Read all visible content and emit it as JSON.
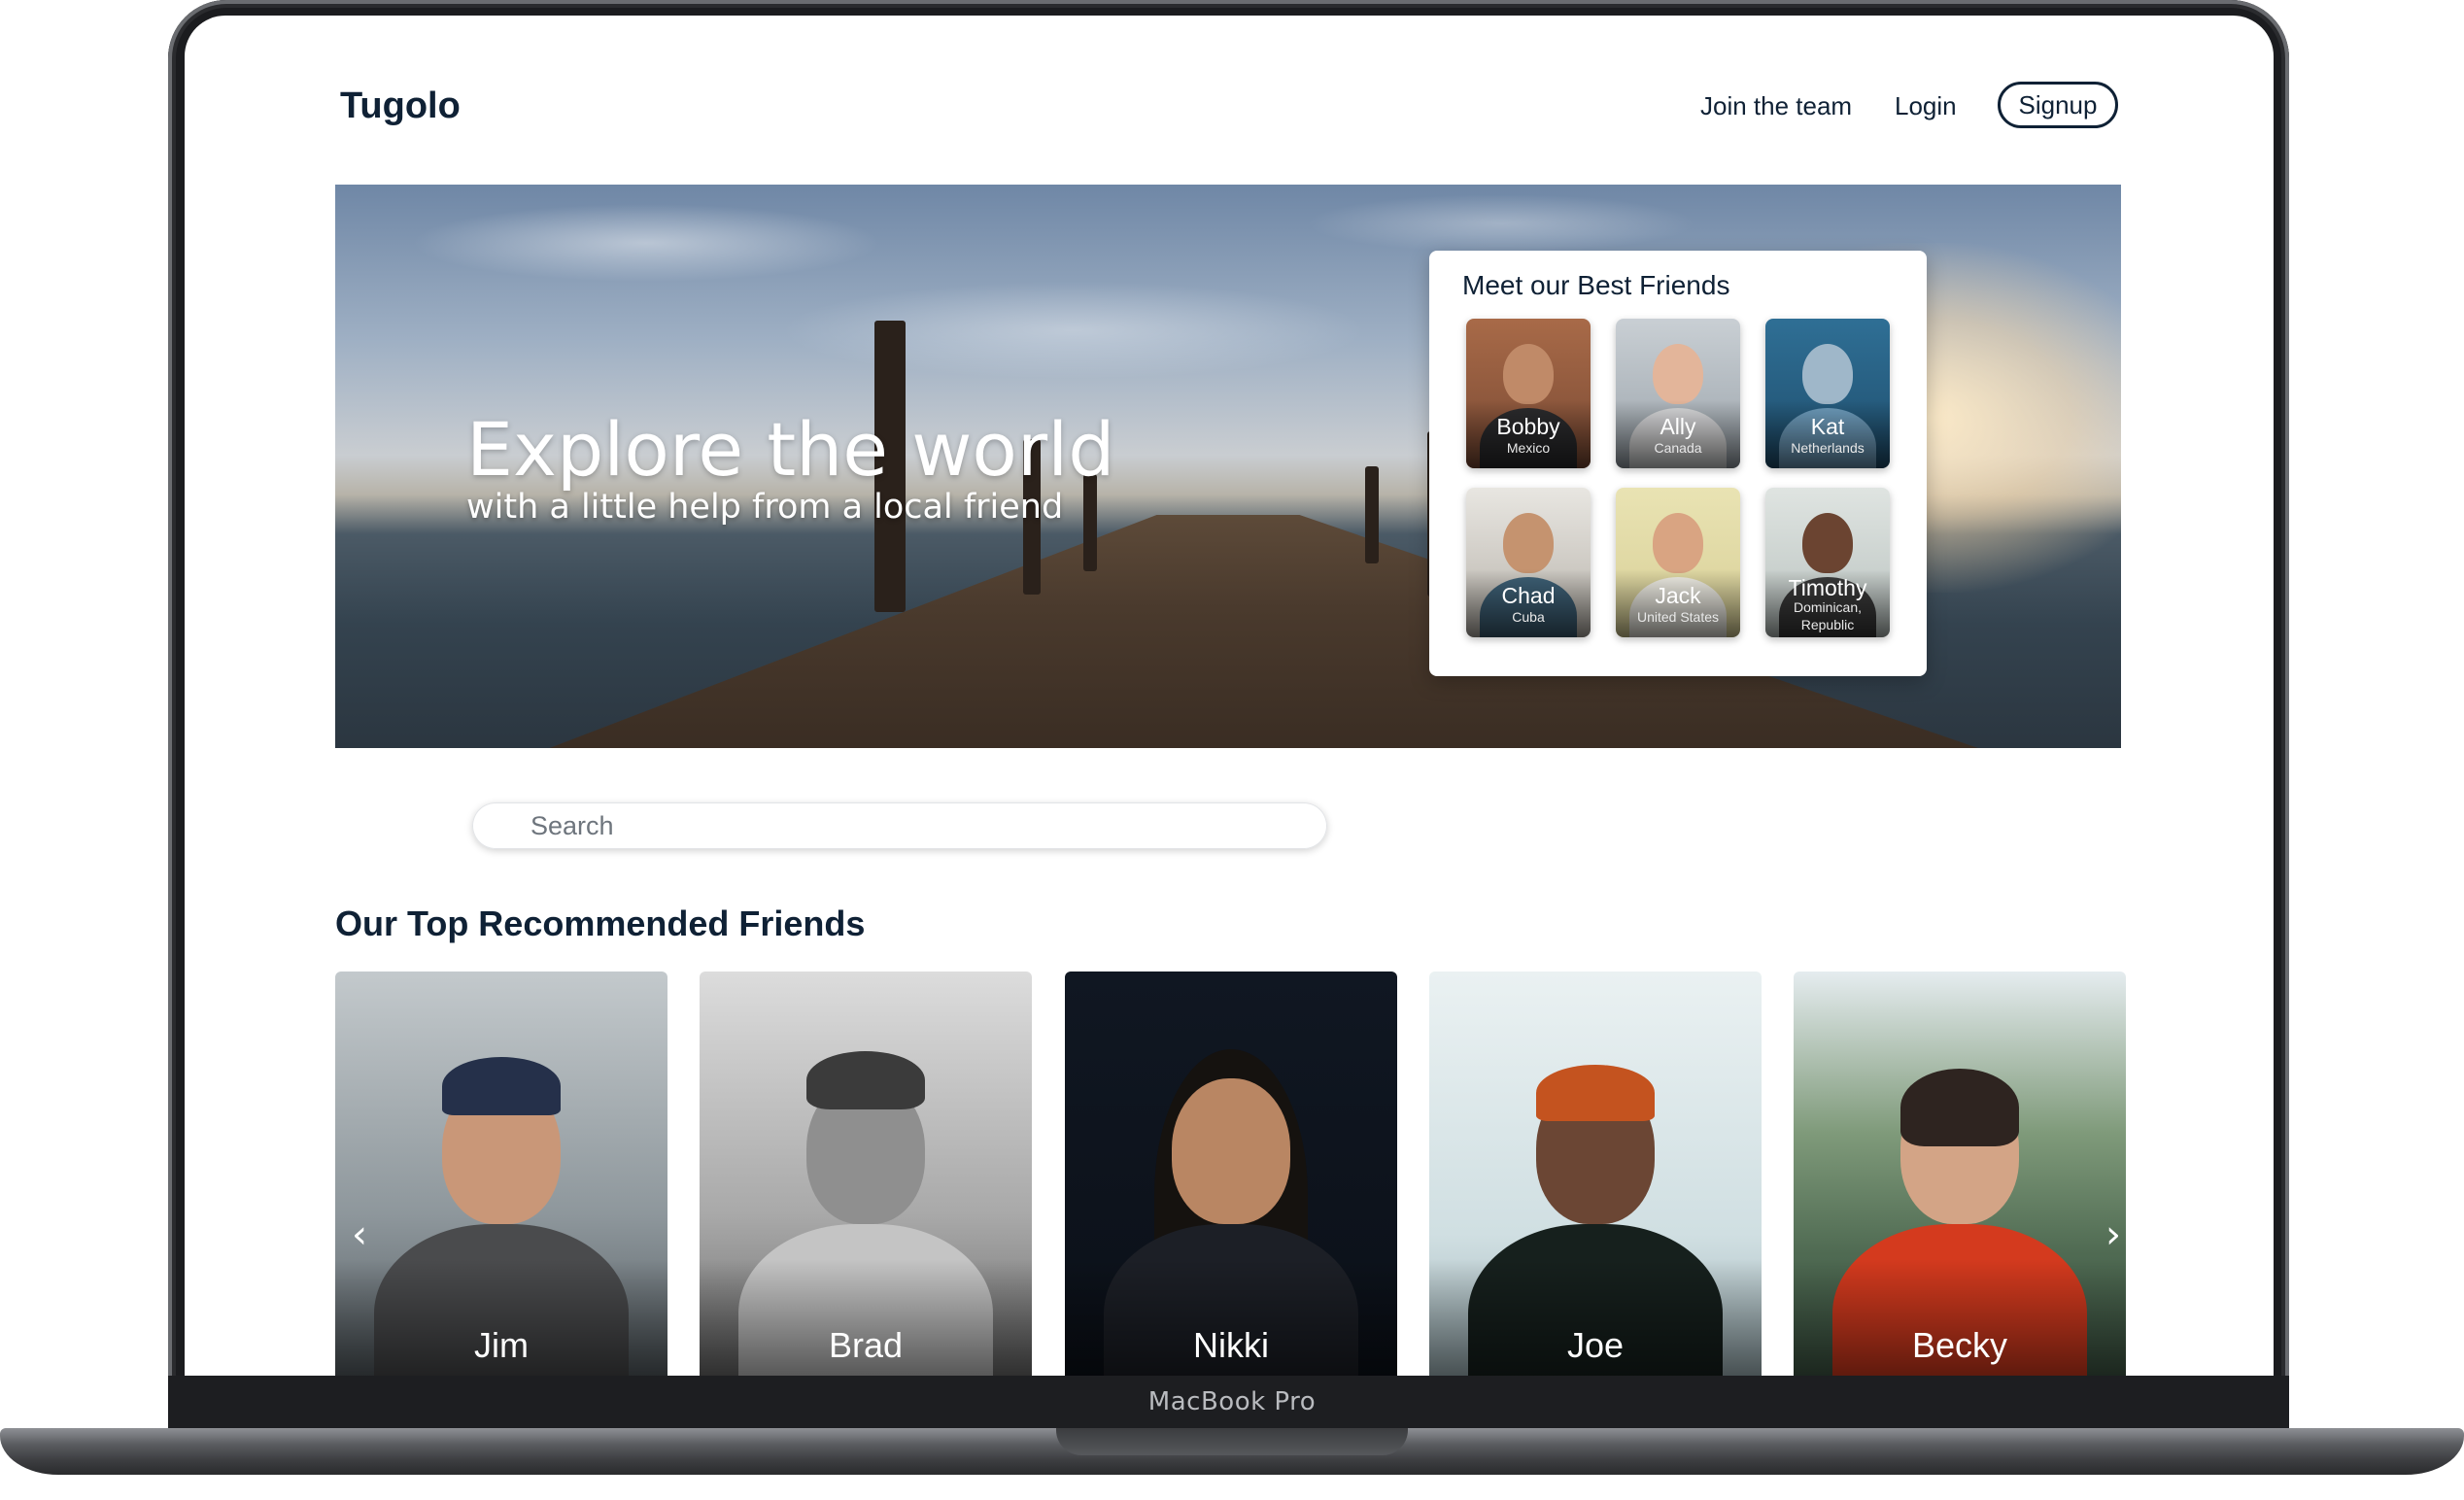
{
  "device": {
    "label": "MacBook Pro"
  },
  "header": {
    "logo": "Tugolo",
    "nav": [
      {
        "label": "Join the team"
      },
      {
        "label": "Login"
      }
    ],
    "signup_label": "Signup"
  },
  "hero": {
    "title": "Explore the world",
    "subtitle": "with a little help from a local friend"
  },
  "best_friends": {
    "title": "Meet our Best Friends",
    "friends": [
      {
        "name": "Bobby",
        "country": "Mexico"
      },
      {
        "name": "Ally",
        "country": "Canada"
      },
      {
        "name": "Kat",
        "country": "Netherlands"
      },
      {
        "name": "Chad",
        "country": "Cuba"
      },
      {
        "name": "Jack",
        "country": "United States"
      },
      {
        "name": "Timothy",
        "country": "Dominican, Republic"
      }
    ]
  },
  "search": {
    "placeholder": "Search",
    "value": ""
  },
  "recommended": {
    "title": "Our Top Recommended Friends",
    "friends": [
      {
        "name": "Jim"
      },
      {
        "name": "Brad"
      },
      {
        "name": "Nikki"
      },
      {
        "name": "Joe"
      },
      {
        "name": "Becky"
      }
    ],
    "prev_icon": "chevron-left-icon",
    "next_icon": "chevron-right-icon"
  }
}
